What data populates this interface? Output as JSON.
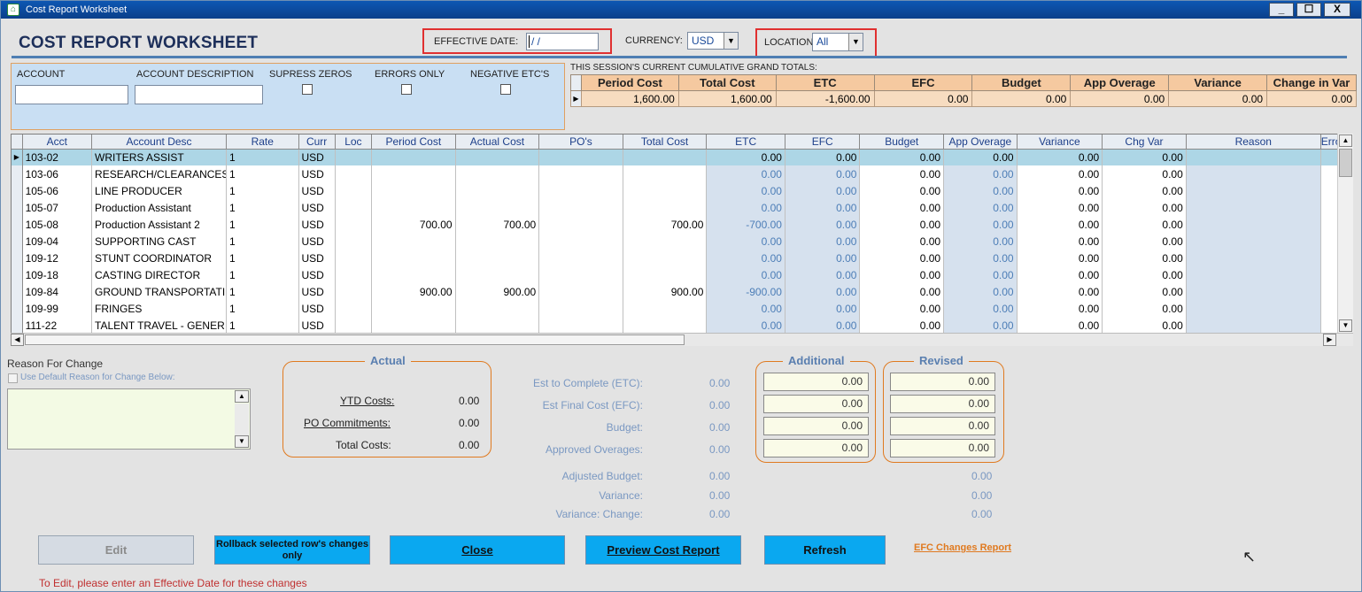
{
  "window": {
    "title": "Cost Report Worksheet",
    "minimize": "_",
    "maximize": "☐",
    "close": "X"
  },
  "header": {
    "title": "COST REPORT WORKSHEET",
    "effective_date_label": "EFFECTIVE DATE:",
    "effective_date_value": " / /",
    "currency_label": "CURRENCY:",
    "currency_value": "USD",
    "location_label": "LOCATION:",
    "location_value": "All"
  },
  "filters": {
    "account_label": "ACCOUNT",
    "account_desc_label": "ACCOUNT DESCRIPTION",
    "supress_zeros_label": "SUPRESS ZEROS",
    "errors_only_label": "ERRORS ONLY",
    "negative_etc_label": "NEGATIVE ETC'S"
  },
  "totals": {
    "caption": "THIS SESSION'S CURRENT CUMULATIVE GRAND TOTALS:",
    "headers": [
      "Period Cost",
      "Total Cost",
      "ETC",
      "EFC",
      "Budget",
      "App Overage",
      "Variance",
      "Change in Var"
    ],
    "values": [
      "1,600.00",
      "1,600.00",
      "-1,600.00",
      "0.00",
      "0.00",
      "0.00",
      "0.00",
      "0.00"
    ]
  },
  "grid": {
    "columns": [
      "Acct",
      "Account Desc",
      "Rate",
      "Curr",
      "Loc",
      "Period Cost",
      "Actual Cost",
      "PO's",
      "Total Cost",
      "ETC",
      "EFC",
      "Budget",
      "App Overage",
      "Variance",
      "Chg Var",
      "Reason",
      "Erro"
    ],
    "rows": [
      {
        "acct": "103-02",
        "desc": "WRITERS ASSIST",
        "rate": "1",
        "curr": "USD",
        "loc": "",
        "period": "",
        "actual": "",
        "pos": "",
        "total": "",
        "etc": "0.00",
        "efc": "0.00",
        "budget": "0.00",
        "app": "0.00",
        "var": "0.00",
        "chg": "0.00"
      },
      {
        "acct": "103-06",
        "desc": "RESEARCH/CLEARANCES",
        "rate": "1",
        "curr": "USD",
        "loc": "",
        "period": "",
        "actual": "",
        "pos": "",
        "total": "",
        "etc": "0.00",
        "efc": "0.00",
        "budget": "0.00",
        "app": "0.00",
        "var": "0.00",
        "chg": "0.00"
      },
      {
        "acct": "105-06",
        "desc": "LINE PRODUCER",
        "rate": "1",
        "curr": "USD",
        "loc": "",
        "period": "",
        "actual": "",
        "pos": "",
        "total": "",
        "etc": "0.00",
        "efc": "0.00",
        "budget": "0.00",
        "app": "0.00",
        "var": "0.00",
        "chg": "0.00"
      },
      {
        "acct": "105-07",
        "desc": "Production Assistant",
        "rate": "1",
        "curr": "USD",
        "loc": "",
        "period": "",
        "actual": "",
        "pos": "",
        "total": "",
        "etc": "0.00",
        "efc": "0.00",
        "budget": "0.00",
        "app": "0.00",
        "var": "0.00",
        "chg": "0.00"
      },
      {
        "acct": "105-08",
        "desc": "Production Assistant 2",
        "rate": "1",
        "curr": "USD",
        "loc": "",
        "period": "700.00",
        "actual": "700.00",
        "pos": "",
        "total": "700.00",
        "etc": "-700.00",
        "efc": "0.00",
        "budget": "0.00",
        "app": "0.00",
        "var": "0.00",
        "chg": "0.00"
      },
      {
        "acct": "109-04",
        "desc": "SUPPORTING CAST",
        "rate": "1",
        "curr": "USD",
        "loc": "",
        "period": "",
        "actual": "",
        "pos": "",
        "total": "",
        "etc": "0.00",
        "efc": "0.00",
        "budget": "0.00",
        "app": "0.00",
        "var": "0.00",
        "chg": "0.00"
      },
      {
        "acct": "109-12",
        "desc": "STUNT COORDINATOR",
        "rate": "1",
        "curr": "USD",
        "loc": "",
        "period": "",
        "actual": "",
        "pos": "",
        "total": "",
        "etc": "0.00",
        "efc": "0.00",
        "budget": "0.00",
        "app": "0.00",
        "var": "0.00",
        "chg": "0.00"
      },
      {
        "acct": "109-18",
        "desc": "CASTING DIRECTOR",
        "rate": "1",
        "curr": "USD",
        "loc": "",
        "period": "",
        "actual": "",
        "pos": "",
        "total": "",
        "etc": "0.00",
        "efc": "0.00",
        "budget": "0.00",
        "app": "0.00",
        "var": "0.00",
        "chg": "0.00"
      },
      {
        "acct": "109-84",
        "desc": "GROUND TRANSPORTATI",
        "rate": "1",
        "curr": "USD",
        "loc": "",
        "period": "900.00",
        "actual": "900.00",
        "pos": "",
        "total": "900.00",
        "etc": "-900.00",
        "efc": "0.00",
        "budget": "0.00",
        "app": "0.00",
        "var": "0.00",
        "chg": "0.00"
      },
      {
        "acct": "109-99",
        "desc": "FRINGES",
        "rate": "1",
        "curr": "USD",
        "loc": "",
        "period": "",
        "actual": "",
        "pos": "",
        "total": "",
        "etc": "0.00",
        "efc": "0.00",
        "budget": "0.00",
        "app": "0.00",
        "var": "0.00",
        "chg": "0.00"
      },
      {
        "acct": "111-22",
        "desc": "TALENT TRAVEL - GENER",
        "rate": "1",
        "curr": "USD",
        "loc": "",
        "period": "",
        "actual": "",
        "pos": "",
        "total": "",
        "etc": "0.00",
        "efc": "0.00",
        "budget": "0.00",
        "app": "0.00",
        "var": "0.00",
        "chg": "0.00"
      }
    ]
  },
  "reason": {
    "label": "Reason For Change",
    "use_default_label": "Use Default Reason for Change Below:"
  },
  "actual": {
    "title": "Actual",
    "ytd_label": "YTD Costs:",
    "ytd_value": "0.00",
    "po_label": "PO Commitments:",
    "po_value": "0.00",
    "total_label": "Total Costs:",
    "total_value": "0.00"
  },
  "estimates": {
    "etc_label": "Est to Complete (ETC):",
    "etc_value": "0.00",
    "efc_label": "Est Final Cost (EFC):",
    "efc_value": "0.00",
    "budget_label": "Budget:",
    "budget_value": "0.00",
    "approved_label": "Approved Overages:",
    "approved_value": "0.00",
    "adjusted_label": "Adjusted Budget:",
    "adjusted_value": "0.00",
    "adjusted_revised": "0.00",
    "variance_label": "Variance:",
    "variance_value": "0.00",
    "variance_revised": "0.00",
    "varchange_label": "Variance: Change:",
    "varchange_value": "0.00",
    "varchange_revised": "0.00"
  },
  "additional": {
    "title": "Additional",
    "values": [
      "0.00",
      "0.00",
      "0.00",
      "0.00"
    ]
  },
  "revised": {
    "title": "Revised",
    "values": [
      "0.00",
      "0.00",
      "0.00",
      "0.00"
    ]
  },
  "buttons": {
    "edit": "Edit",
    "rollback": "Rollback selected row's changes only",
    "close": "Close",
    "preview": "Preview Cost Report",
    "refresh": "Refresh",
    "efc_link": "EFC Changes Report"
  },
  "status_message": "To Edit, please enter an Effective Date for these changes",
  "colors": {
    "accent": "#0aa8f0",
    "highlight_box": "#e03030",
    "group_border": "#e07a20",
    "link": "#e07a20",
    "status": "#c03030"
  }
}
